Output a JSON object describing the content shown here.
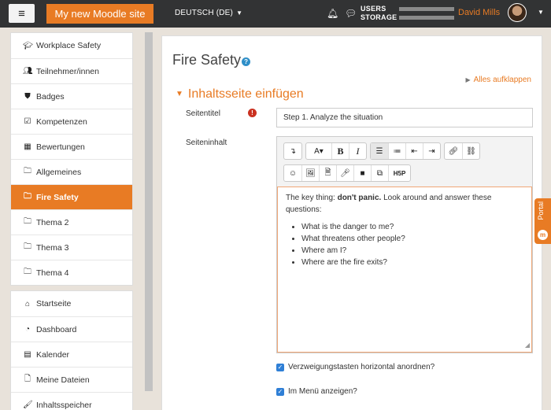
{
  "topbar": {
    "menu_icon": "hamburger-icon",
    "site_name": "My new Moodle site",
    "language": "DEUTSCH (DE)",
    "storage_line1": "USERS",
    "storage_line2": "STORAGE",
    "user_name": "David Mills"
  },
  "sidebar": {
    "course_items": [
      {
        "label": "Workplace Safety",
        "icon": "graduation-cap-icon"
      },
      {
        "label": "Teilnehmer/innen",
        "icon": "users-icon"
      },
      {
        "label": "Badges",
        "icon": "shield-icon"
      },
      {
        "label": "Kompetenzen",
        "icon": "checkbox-icon"
      },
      {
        "label": "Bewertungen",
        "icon": "table-icon"
      },
      {
        "label": "Allgemeines",
        "icon": "folder-icon"
      },
      {
        "label": "Fire Safety",
        "icon": "folder-icon",
        "active": true
      },
      {
        "label": "Thema 2",
        "icon": "folder-icon"
      },
      {
        "label": "Thema 3",
        "icon": "folder-icon"
      },
      {
        "label": "Thema 4",
        "icon": "folder-icon"
      }
    ],
    "site_items": [
      {
        "label": "Startseite",
        "icon": "home-icon"
      },
      {
        "label": "Dashboard",
        "icon": "dashboard-icon"
      },
      {
        "label": "Kalender",
        "icon": "calendar-icon"
      },
      {
        "label": "Meine Dateien",
        "icon": "file-icon"
      },
      {
        "label": "Inhaltsspeicher",
        "icon": "brush-icon"
      }
    ]
  },
  "main": {
    "page_title": "Fire Safety",
    "expand_all": "Alles aufklappen",
    "section_title": "Inhaltsseite einfügen",
    "field_title_label": "Seitentitel",
    "field_title_value": "Step 1. Analyze the situation",
    "field_content_label": "Seiteninhalt",
    "editor": {
      "intro_prefix": "The key thing: ",
      "intro_bold": "don't panic.",
      "intro_suffix": " Look around and answer these questions:",
      "bullets": [
        "What is the danger to me?",
        "What threatens other people?",
        "Where am I?",
        "Where are the fire exits?"
      ]
    },
    "checkbox_horizontal": "Verzweigungstasten horizontal anordnen?",
    "checkbox_menu": "Im Menü anzeigen?"
  },
  "portal_tab": "Portal",
  "colors": {
    "accent": "#e87b24",
    "topbar": "#323334",
    "required": "#ca3120"
  }
}
